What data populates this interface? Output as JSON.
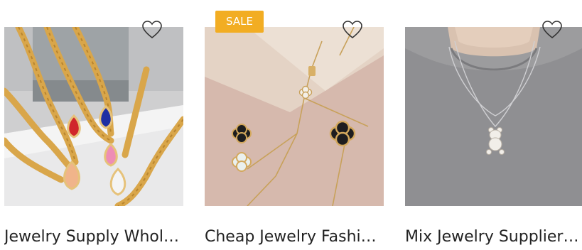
{
  "products": [
    {
      "title": "Jewelry Supply Whol…",
      "image": "gold-chain-necklaces-with-gems",
      "favorite_icon": "heart-outline-icon"
    },
    {
      "title": "Cheap Jewelry Fashi…",
      "image": "gold-clover-pendant-necklace",
      "badge": "SALE",
      "favorite_icon": "heart-outline-icon"
    },
    {
      "title": "Mix Jewelry Supplier…",
      "image": "silver-bear-pendant-necklace-on-model",
      "favorite_icon": "heart-outline-icon"
    }
  ],
  "colors": {
    "sale_badge": "#f2ad23",
    "title_text": "#222222",
    "heart_icon": "#333333"
  }
}
